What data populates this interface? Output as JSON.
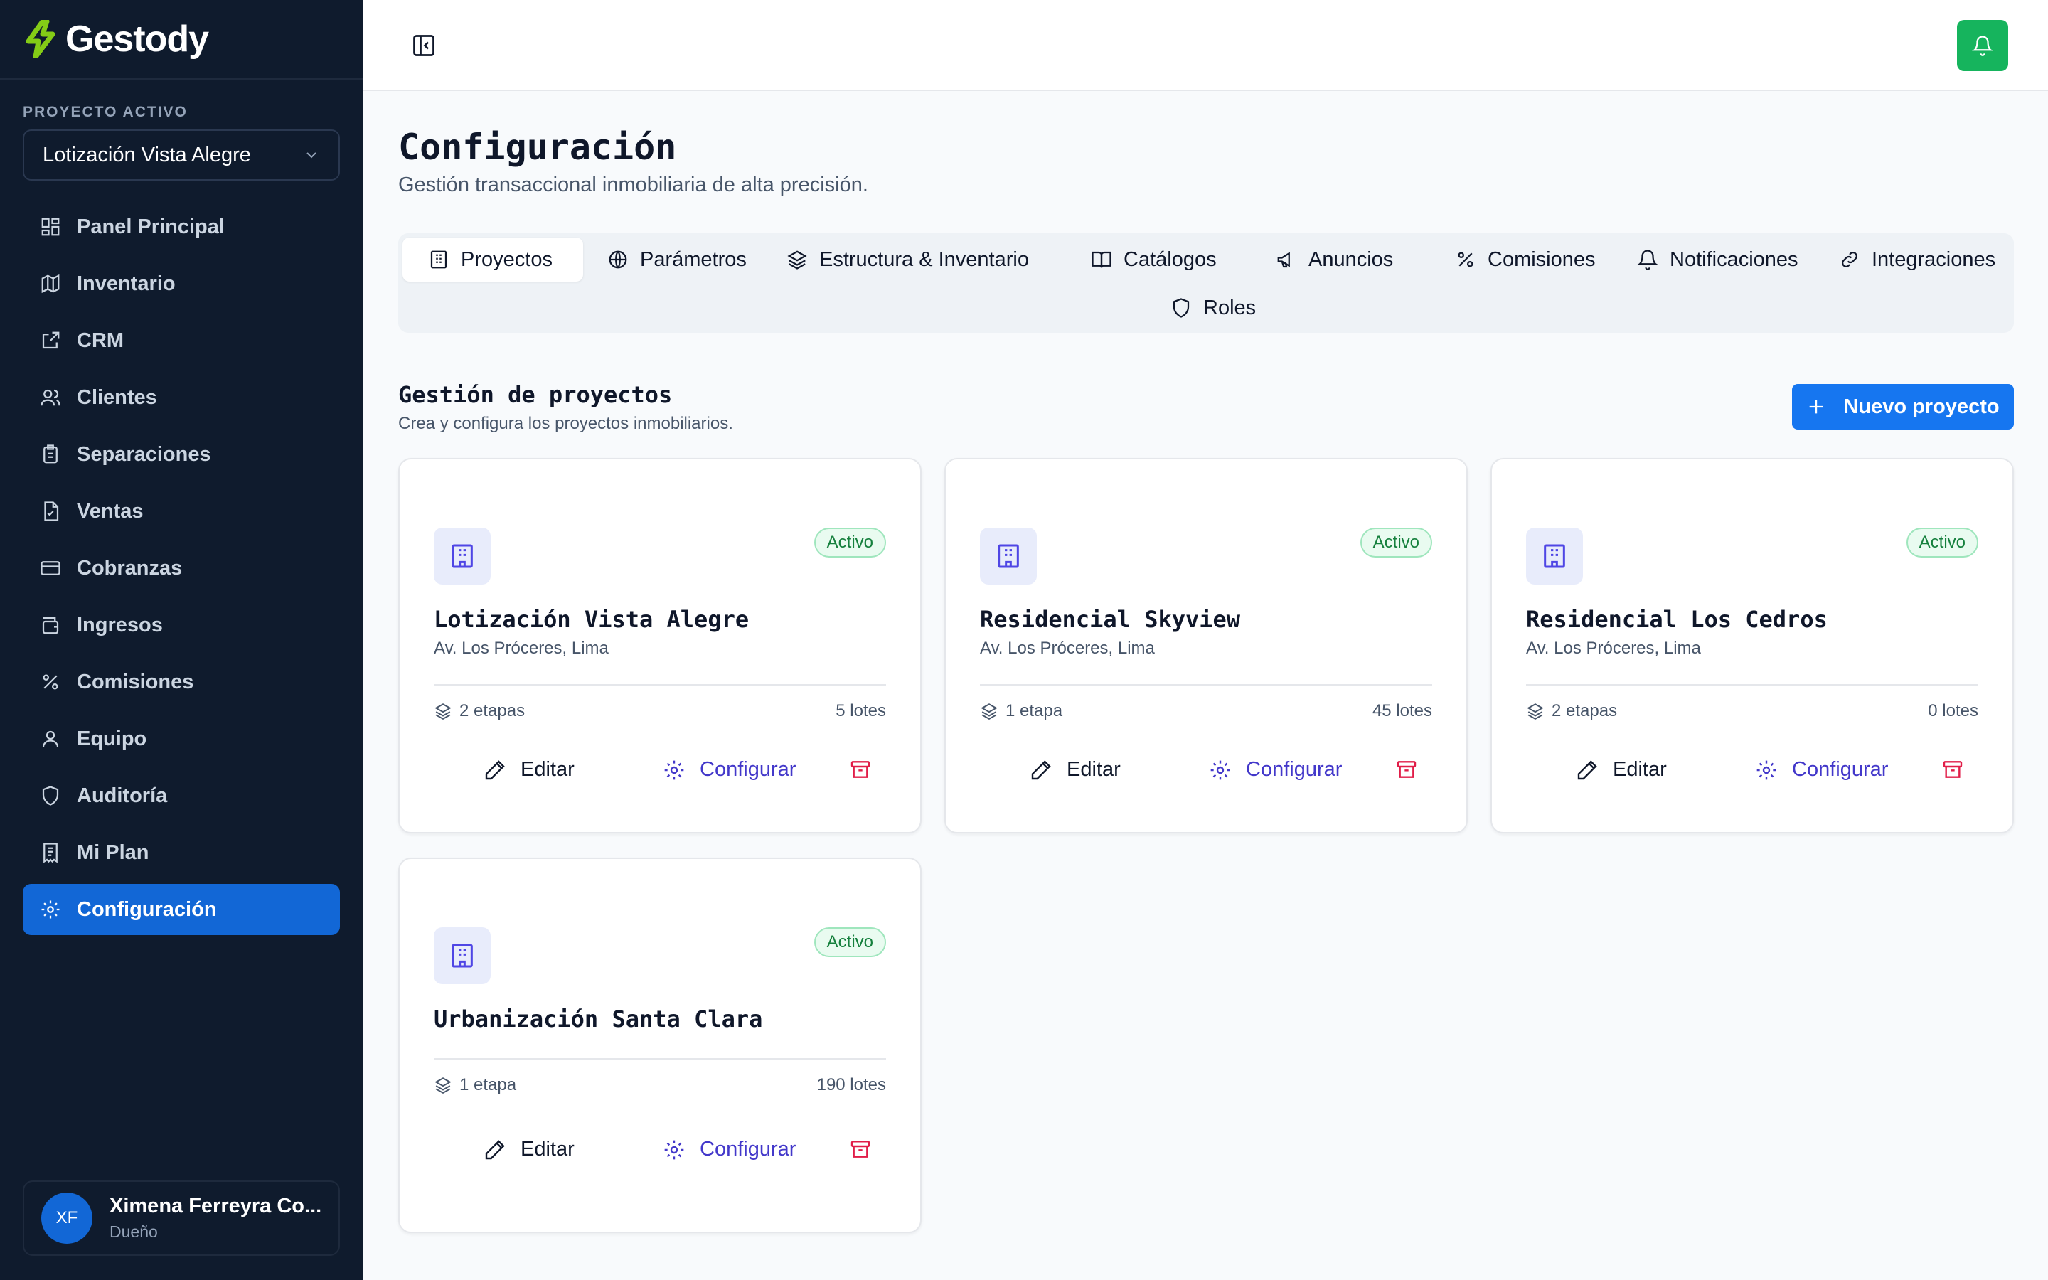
{
  "brand": {
    "name": "Gestody",
    "accent": "#84cc16"
  },
  "sidebar": {
    "project_label": "PROYECTO ACTIVO",
    "project_selected": "Lotización Vista Alegre",
    "items": [
      {
        "label": "Panel Principal",
        "icon": "dashboard-icon"
      },
      {
        "label": "Inventario",
        "icon": "map-icon"
      },
      {
        "label": "CRM",
        "icon": "external-link-icon"
      },
      {
        "label": "Clientes",
        "icon": "users-icon"
      },
      {
        "label": "Separaciones",
        "icon": "clipboard-icon"
      },
      {
        "label": "Ventas",
        "icon": "file-check-icon"
      },
      {
        "label": "Cobranzas",
        "icon": "credit-card-icon"
      },
      {
        "label": "Ingresos",
        "icon": "wallet-icon"
      },
      {
        "label": "Comisiones",
        "icon": "percent-icon"
      },
      {
        "label": "Equipo",
        "icon": "user-icon"
      },
      {
        "label": "Auditoría",
        "icon": "shield-icon"
      },
      {
        "label": "Mi Plan",
        "icon": "receipt-icon"
      },
      {
        "label": "Configuración",
        "icon": "gear-icon",
        "active": true
      }
    ],
    "user": {
      "initials": "XF",
      "name": "Ximena Ferreyra Co...",
      "role": "Dueño"
    }
  },
  "header": {
    "title": "Configuración",
    "subtitle": "Gestión transaccional inmobiliaria de alta precisión."
  },
  "tabs": [
    {
      "label": "Proyectos",
      "icon": "building-icon",
      "active": true
    },
    {
      "label": "Parámetros",
      "icon": "globe-icon"
    },
    {
      "label": "Estructura & Inventario",
      "icon": "layers-icon"
    },
    {
      "label": "Catálogos",
      "icon": "book-icon"
    },
    {
      "label": "Anuncios",
      "icon": "megaphone-icon"
    },
    {
      "label": "Comisiones",
      "icon": "percent-icon"
    },
    {
      "label": "Notificaciones",
      "icon": "bell-icon"
    },
    {
      "label": "Integraciones",
      "icon": "link-icon"
    },
    {
      "label": "Roles",
      "icon": "shield-icon"
    }
  ],
  "section": {
    "title": "Gestión de proyectos",
    "subtitle": "Crea y configura los proyectos inmobiliarios.",
    "new_button": "Nuevo proyecto"
  },
  "projects": [
    {
      "name": "Lotización Vista Alegre",
      "address": "Av. Los Próceres, Lima",
      "status": "Activo",
      "stages": "2 etapas",
      "lots": "5 lotes"
    },
    {
      "name": "Residencial Skyview",
      "address": "Av. Los Próceres, Lima",
      "status": "Activo",
      "stages": "1 etapa",
      "lots": "45 lotes"
    },
    {
      "name": "Residencial Los Cedros",
      "address": "Av. Los Próceres, Lima",
      "status": "Activo",
      "stages": "2 etapas",
      "lots": "0 lotes"
    },
    {
      "name": "Urbanización Santa Clara",
      "address": "",
      "status": "Activo",
      "stages": "1 etapa",
      "lots": "190 lotes"
    }
  ],
  "actions": {
    "edit": "Editar",
    "configure": "Configurar"
  },
  "colors": {
    "sidebar_bg": "#0f1b2d",
    "primary": "#1676f0",
    "active_nav": "#1267d6",
    "bell": "#16b45d",
    "success": "#15803d",
    "danger": "#e11d48"
  }
}
